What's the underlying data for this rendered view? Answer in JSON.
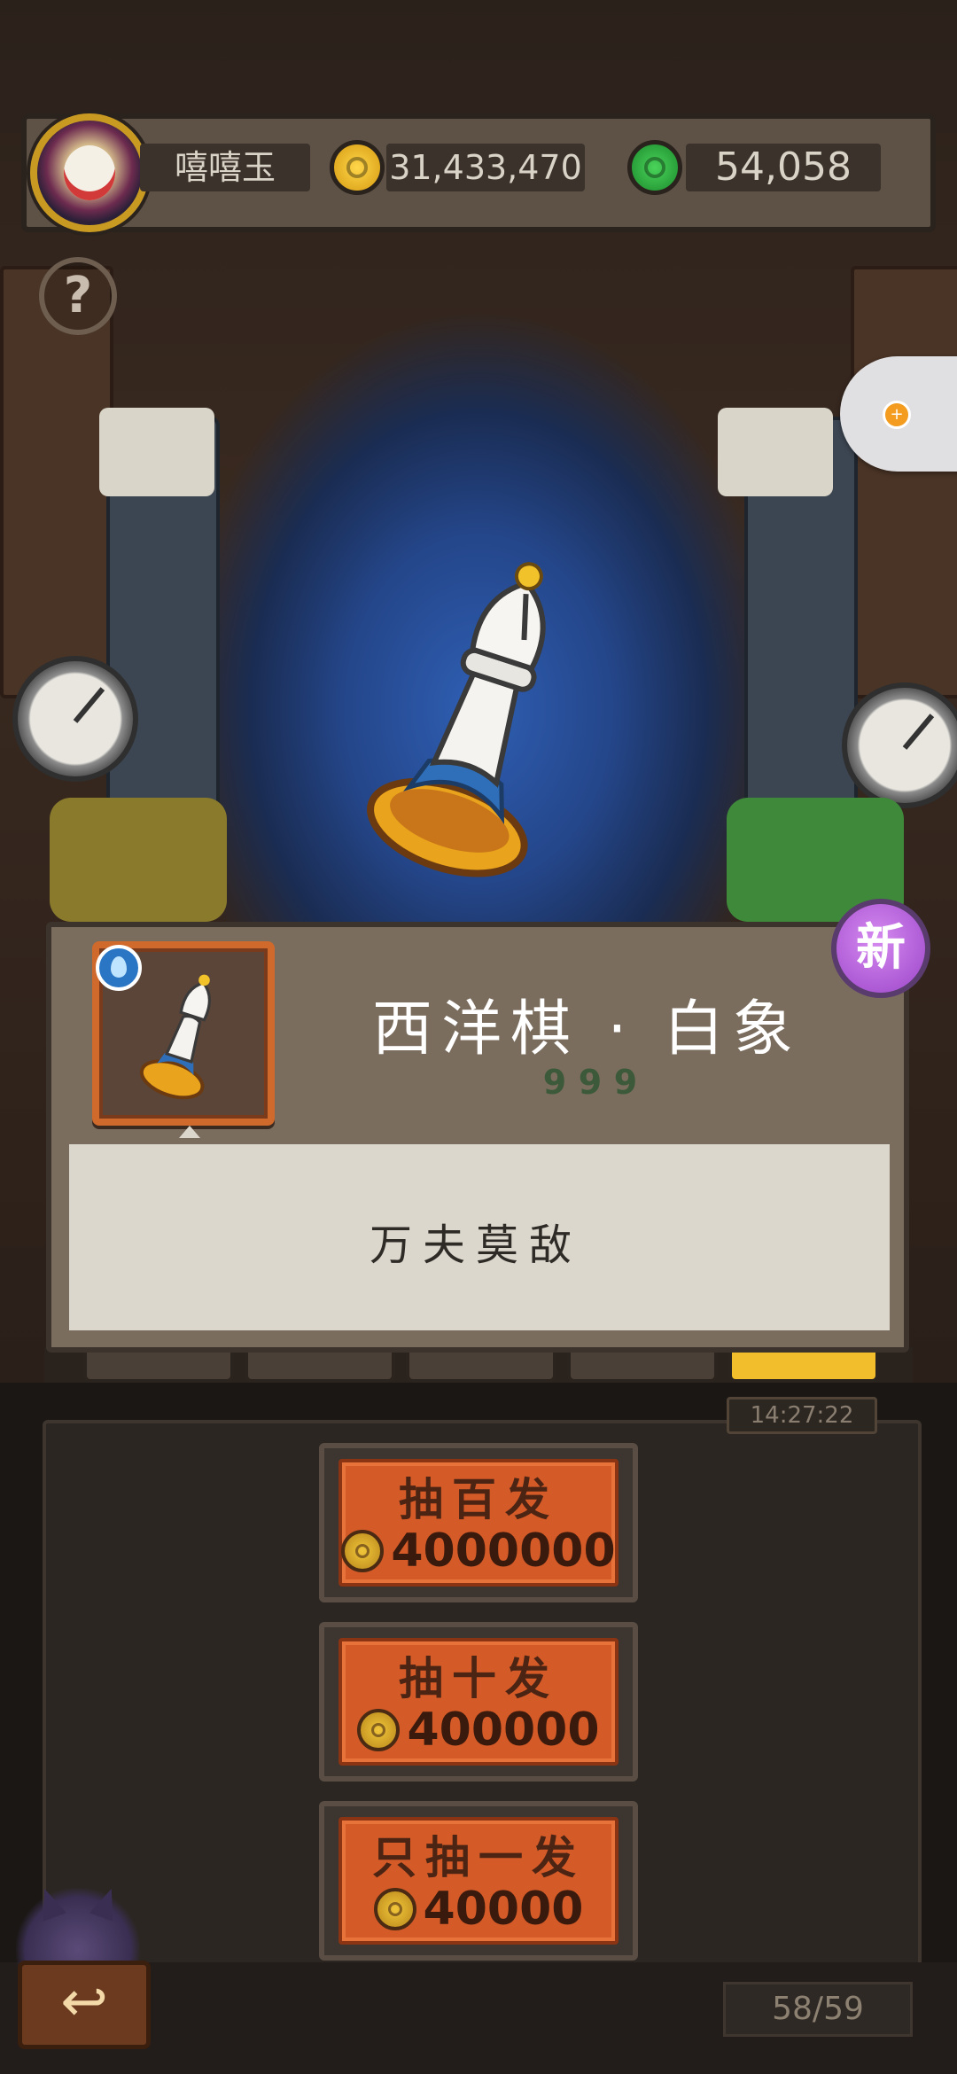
{
  "header": {
    "player_name": "嘻嘻玉",
    "gold_amount": "31,433,470",
    "gem_amount": "54,058",
    "help_label": "?"
  },
  "reward": {
    "item_name": "西洋棋 · 白象",
    "rarity_marks": [
      "9",
      "9",
      "9"
    ],
    "description": "万夫莫敌",
    "new_badge": "新"
  },
  "shop": {
    "timer": "14:27:22",
    "buttons": [
      {
        "label": "抽百发",
        "cost": "4000000"
      },
      {
        "label": "抽十发",
        "cost": "400000"
      },
      {
        "label": "只抽一发",
        "cost": "40000"
      }
    ]
  },
  "footer": {
    "page_counter": "58/59"
  },
  "colors": {
    "accent_orange": "#d45a28",
    "gold": "#d59a10",
    "gem_green": "#1c8a2c",
    "new_badge_purple": "#9b45c9"
  }
}
